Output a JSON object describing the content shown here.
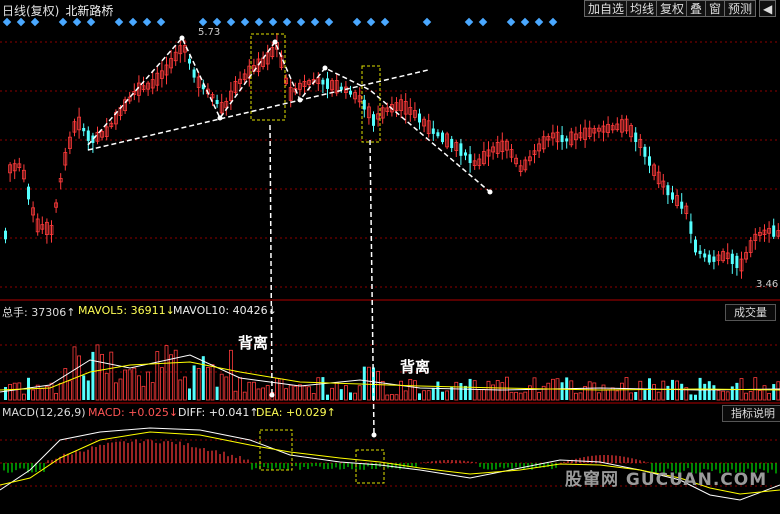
{
  "header": {
    "period_label": "日线(复权)",
    "stock_name": "北新路桥",
    "buttons": [
      "加自选",
      "均线",
      "复权",
      "叠",
      "窗",
      "预测",
      "◀"
    ]
  },
  "price_panel": {
    "high_label": "5.73",
    "low_label": "3.46"
  },
  "volume_panel": {
    "total_label": "总手: 37306↑",
    "mavol5_label": "MAVOL5: 36911↓",
    "mavol10_label": "MAVOL10: 40426↓",
    "tag": "成交量"
  },
  "macd_panel": {
    "name_label": "MACD(12,26,9)",
    "macd_label": "MACD: +0.025↓",
    "diff_label": "DIFF: +0.041↑",
    "dea_label": "DEA: +0.029↑",
    "tag": "指标说明"
  },
  "annotations": {
    "divergence_1": "背离",
    "divergence_2": "背离"
  },
  "watermark": "股窜网 GUCUAN.COM",
  "colors": {
    "up": "#ff3b3b",
    "down": "#54ffff",
    "ma5": "#ffffff",
    "ma10": "#ffff00",
    "diff": "#ffffff",
    "dea": "#ffff00",
    "macd_pos": "#ff3b3b",
    "macd_neg": "#00dd00",
    "grid": "#8b0000",
    "marker": "#4aa8ff"
  },
  "chart_data": {
    "type": "candlestick",
    "price_range": [
      3.3,
      5.9
    ],
    "highest": 5.73,
    "lowest": 3.46
  }
}
